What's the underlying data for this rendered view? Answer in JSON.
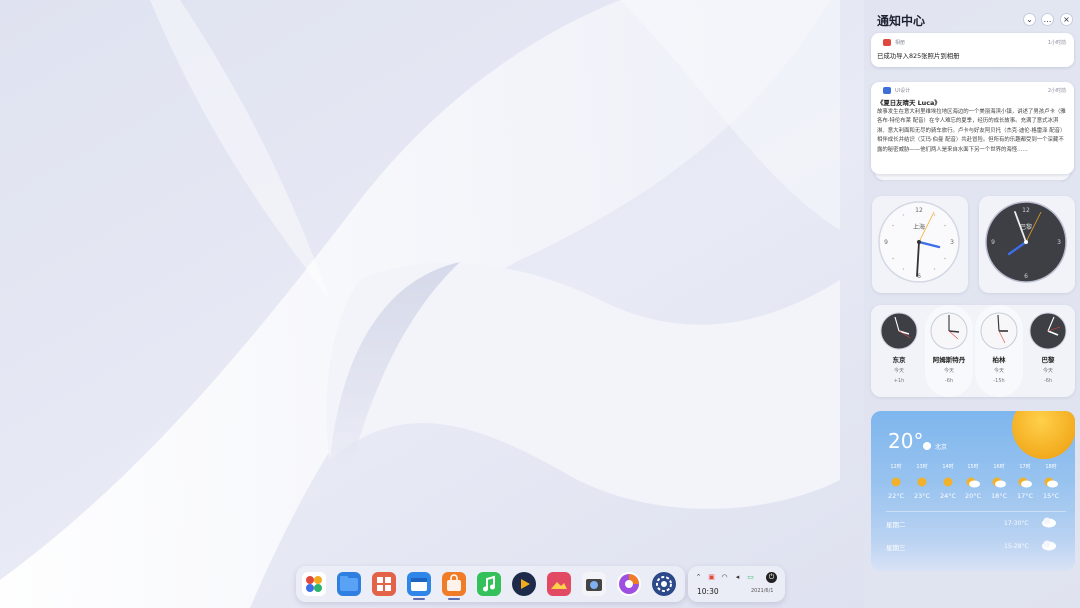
{
  "notification_center": {
    "title": "通知中心",
    "controls": {
      "collapse": "⌄",
      "more": "…",
      "close": "×"
    },
    "notifications": [
      {
        "app": "相册",
        "time": "1小时前",
        "message": "已成功导入825张照片到相册"
      },
      {
        "app": "UI设计",
        "time": "2小时前",
        "subject": "《夏日友晴天 Luca》",
        "body": "故事发生在意大利里维埃拉地区海边的一个美丽海滨小镇，讲述了男孩卢卡（雅各布·特伦布莱 配音）在令人难忘的夏季，经历的成长故事。充满了意式冰淇淋、意大利面和无尽的骑车旅行。卢卡与好友阿贝托（杰克·迪伦·格雷泽 配音）相伴成长并结识（艾玛·伯曼 配音）共赴冒险。但所有的乐趣都受到一个深藏不露的秘密威胁——他们两人是来自水面下另一个世界的海怪……"
      }
    ]
  },
  "clocks": [
    {
      "city": "上海"
    },
    {
      "city": "巴黎"
    }
  ],
  "world_clocks": [
    {
      "city": "东京",
      "day": "今天",
      "offset": "+1h"
    },
    {
      "city": "阿姆斯特丹",
      "day": "今天",
      "offset": "-6h"
    },
    {
      "city": "柏林",
      "day": "今天",
      "offset": "-15h"
    },
    {
      "city": "巴黎",
      "day": "今天",
      "offset": "-6h"
    }
  ],
  "weather": {
    "temperature": "20°",
    "location": "北京",
    "hourly": [
      {
        "hour": "12时",
        "temp": "22°C",
        "icon": "sun-icon"
      },
      {
        "hour": "13时",
        "temp": "23°C",
        "icon": "sun-icon"
      },
      {
        "hour": "14时",
        "temp": "24°C",
        "icon": "sun-icon"
      },
      {
        "hour": "15时",
        "temp": "20°C",
        "icon": "cloud-sun-icon"
      },
      {
        "hour": "16时",
        "temp": "18°C",
        "icon": "cloud-sun-icon"
      },
      {
        "hour": "17时",
        "temp": "17°C",
        "icon": "cloud-sun-icon"
      },
      {
        "hour": "18时",
        "temp": "15°C",
        "icon": "cloud-sun-icon"
      }
    ],
    "daily": [
      {
        "day": "星期二",
        "range": "17-30°C"
      },
      {
        "day": "星期三",
        "range": "15-28°C"
      }
    ]
  },
  "dock": {
    "apps": [
      "launcher",
      "file-manager",
      "app-store",
      "calendar",
      "deepin-store",
      "music",
      "video",
      "image-viewer",
      "camera",
      "browser",
      "settings"
    ]
  },
  "tray": {
    "time": "10:30",
    "date": "2021/6/1"
  },
  "colors": {
    "accent": "#3b6ee8",
    "weather_top": "#7eb6ee",
    "sun": "#f2a91c"
  }
}
